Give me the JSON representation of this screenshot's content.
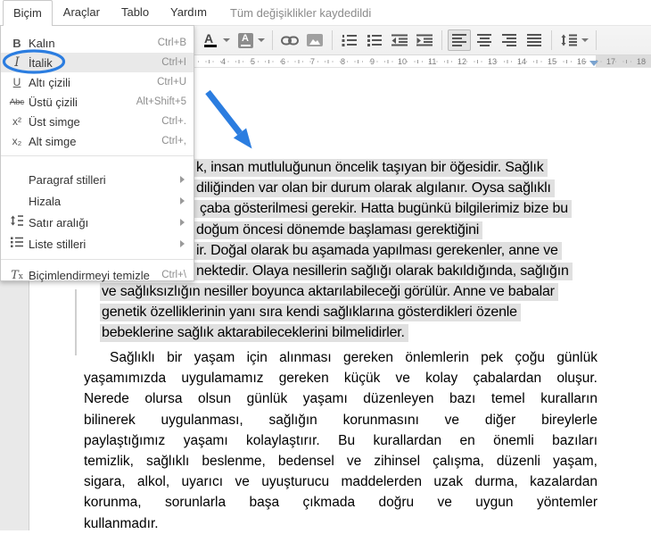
{
  "menubar": {
    "items": [
      "Biçim",
      "Araçlar",
      "Tablo",
      "Yardım"
    ],
    "status": "Tüm değişiklikler kaydedildi"
  },
  "format_menu": {
    "items": [
      {
        "icon": "bold-icon",
        "glyph": "B",
        "label": "Kalın",
        "shortcut": "Ctrl+B"
      },
      {
        "icon": "italic-icon",
        "glyph": "I",
        "label": "İtalik",
        "shortcut": "Ctrl+I",
        "highlighted": true
      },
      {
        "icon": "underline-icon",
        "glyph": "U",
        "label": "Altı çizili",
        "shortcut": "Ctrl+U"
      },
      {
        "icon": "strikethrough-icon",
        "glyph": "Abc",
        "label": "Üstü çizili",
        "shortcut": "Alt+Shift+5"
      },
      {
        "icon": "superscript-icon",
        "glyph": "x²",
        "label": "Üst simge",
        "shortcut": "Ctrl+."
      },
      {
        "icon": "subscript-icon",
        "glyph": "x₂",
        "label": "Alt simge",
        "shortcut": "Ctrl+,"
      },
      {
        "label": "Paragraf stilleri",
        "submenu": true
      },
      {
        "label": "Hizala",
        "submenu": true
      },
      {
        "icon": "line-spacing-icon",
        "label": "Satır aralığı",
        "submenu": true
      },
      {
        "icon": "list-styles-icon",
        "label": "Liste stilleri",
        "submenu": true
      },
      {
        "icon": "clear-formatting-icon",
        "glyph": "T",
        "glyph_small": "x",
        "label": "Biçimlendirmeyi temizle",
        "shortcut": "Ctrl+\\"
      }
    ]
  },
  "toolbar": {
    "icons": [
      "text-color-icon",
      "highlight-color-icon",
      "insert-link-icon",
      "insert-image-icon",
      "numbered-list-icon",
      "bulleted-list-icon",
      "decrease-indent-icon",
      "increase-indent-icon",
      "align-left-icon",
      "align-center-icon",
      "align-right-icon",
      "justify-icon",
      "line-spacing-icon"
    ],
    "active": "align-left"
  },
  "ruler": {
    "numbers": [
      "4",
      "5",
      "6",
      "7",
      "8",
      "9",
      "10",
      "11",
      "12",
      "13",
      "14",
      "15",
      "16",
      "17",
      "18"
    ]
  },
  "document": {
    "para1_lines": [
      "k, insan mutluluğunun öncelik taşıyan bir öğesidir. Sağlık",
      "diliğinden var olan bir durum olarak algılanır. Oysa sağlıklı",
      "çaba gösterilmesi gerekir. Hatta bugünkü bilgilerimiz bize bu",
      "doğum öncesi dönemde başlaması gerektiğini",
      "ir. Doğal olarak bu aşamada yapılması gerekenler, anne ve",
      "nektedir. Olaya nesillerin sağlığı olarak bakıldığında, sağlığın",
      "ve sağlıksızlığın nesiller boyunca aktarılabileceği görülür. Anne ve babalar",
      "genetik özelliklerinin yanı sıra kendi sağlıklarına gösterdikleri özenle",
      "bebeklerine sağlık aktarabileceklerini bilmelidirler."
    ],
    "para2_lines": [
      "Sağlıklı bir yaşam için alınması gereken önlemlerin pek çoğu günlük",
      "yaşamımızda uygulamamız gereken küçük ve kolay çabalardan oluşur.",
      "Nerede olursa olsun günlük yaşamı düzenleyen bazı temel kuralların",
      "bilinerek uygulanması, sağlığın korunmasını ve diğer bireylerle",
      "paylaştığımız yaşamı kolaylaştırır. Bu kurallardan en önemli bazıları",
      "temizlik, sağlıklı beslenme, bedensel ve zihinsel çalışma, düzenli yaşam,",
      "sigara, alkol, uyarıcı ve uyuşturucu maddelerden uzak durma, kazalardan",
      "korunma, sorunlarla başa çıkmada doğru ve uygun yöntemler",
      "kullanmadır."
    ]
  },
  "colors": {
    "annotation_blue": "#2b7de0",
    "selection_gray": "#e0e0e0"
  }
}
